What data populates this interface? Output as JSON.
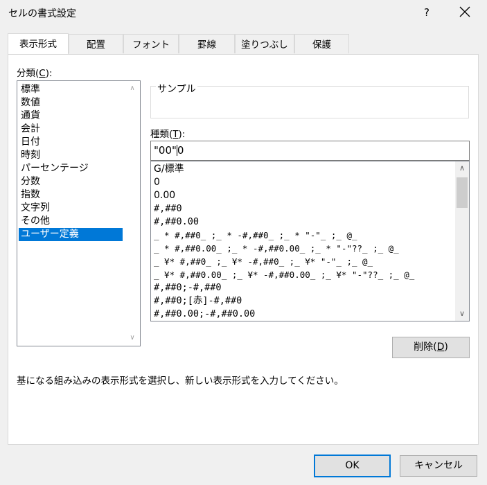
{
  "window": {
    "title": "セルの書式設定",
    "help": "?",
    "close_icon": "close-icon"
  },
  "tabs": [
    {
      "label": "表示形式",
      "active": true
    },
    {
      "label": "配置"
    },
    {
      "label": "フォント"
    },
    {
      "label": "罫線"
    },
    {
      "label": "塗りつぶし"
    },
    {
      "label": "保護"
    }
  ],
  "category": {
    "label_prefix": "分類(",
    "label_key": "C",
    "label_suffix": "):",
    "items": [
      "標準",
      "数値",
      "通貨",
      "会計",
      "日付",
      "時刻",
      "パーセンテージ",
      "分数",
      "指数",
      "文字列",
      "その他",
      "ユーザー定義"
    ],
    "selected": "ユーザー定義"
  },
  "sample": {
    "label": "サンプル",
    "value": ""
  },
  "type": {
    "label_prefix": "種類(",
    "label_key": "T",
    "label_suffix": "):",
    "value_before_caret": "\"00\"",
    "value_after_caret": "0"
  },
  "formats": [
    "G/標準",
    "0",
    "0.00",
    "#,##0",
    "#,##0.00",
    "_ * #,##0_ ;_ * -#,##0_ ;_ * \"-\"_ ;_ @_",
    "_ * #,##0.00_ ;_ * -#,##0.00_ ;_ * \"-\"??_ ;_ @_",
    "_ ¥* #,##0_ ;_ ¥* -#,##0_ ;_ ¥* \"-\"_ ;_ @_",
    "_ ¥* #,##0.00_ ;_ ¥* -#,##0.00_ ;_ ¥* \"-\"??_ ;_ @_",
    "#,##0;-#,##0",
    "#,##0;[赤]-#,##0",
    "#,##0.00;-#,##0.00"
  ],
  "delete": {
    "label_prefix": "削除(",
    "label_key": "D",
    "label_suffix": ")"
  },
  "description": "基になる組み込みの表示形式を選択し、新しい表示形式を入力してください。",
  "buttons": {
    "ok": "OK",
    "cancel": "キャンセル"
  },
  "colors": {
    "selection": "#0078d7",
    "dialog_bg": "#f0f0f0",
    "panel_bg": "#ffffff"
  }
}
